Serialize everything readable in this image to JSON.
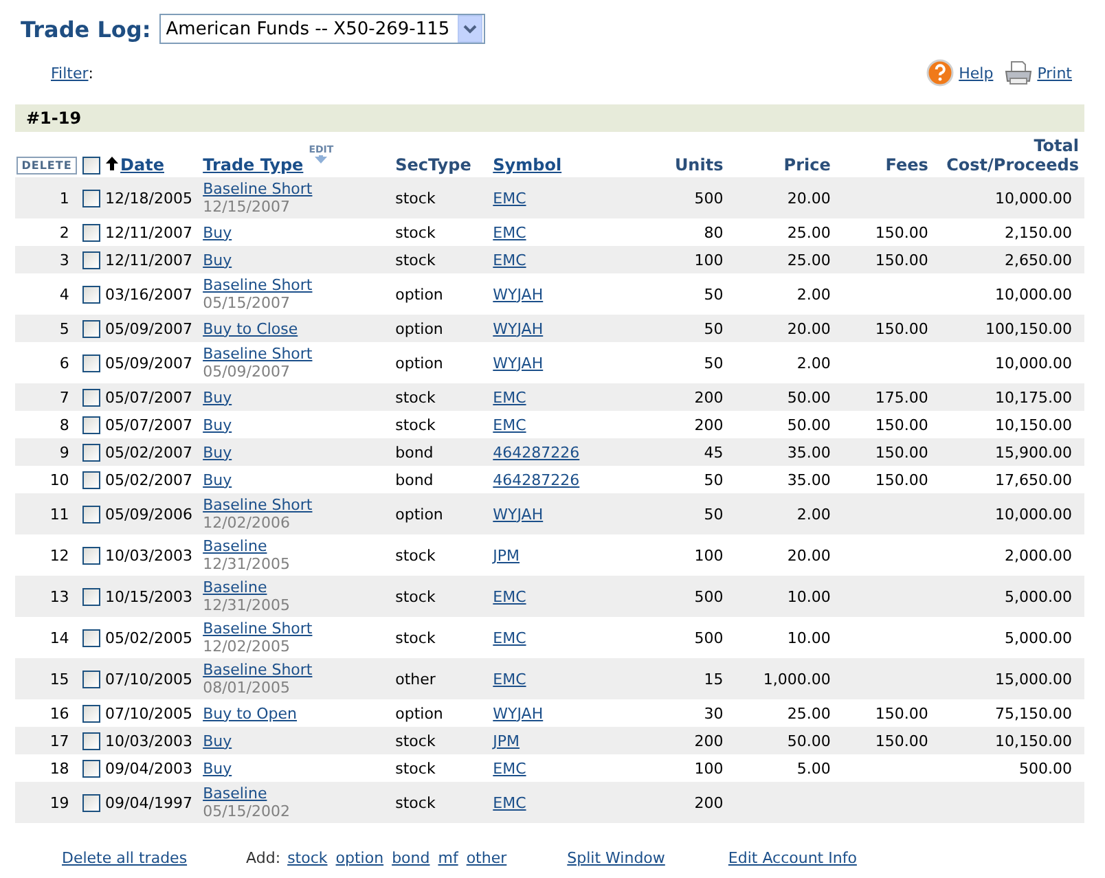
{
  "title": "Trade Log:",
  "account_select": {
    "value": "American Funds -- X50-269-115"
  },
  "filter": {
    "label": "Filter",
    "suffix": ":"
  },
  "toolbar": [
    {
      "kind": "help",
      "label": "Help"
    },
    {
      "kind": "print",
      "label": "Print"
    }
  ],
  "range": "#1-19",
  "delete_button": "DELETE",
  "select_all": {
    "checked": false
  },
  "columns": [
    {
      "label": "Date",
      "kind": "link",
      "sorted": true
    },
    {
      "label": "Trade Type",
      "kind": "link",
      "badge": "EDIT"
    },
    {
      "label": "SecType",
      "kind": "plain"
    },
    {
      "label": "Symbol",
      "kind": "link"
    },
    {
      "label": "Units",
      "kind": "plain"
    },
    {
      "label": "Price",
      "kind": "plain"
    },
    {
      "label": "Fees",
      "kind": "plain"
    },
    {
      "label": "Total Cost/Proceeds",
      "kind": "plain"
    }
  ],
  "rows": [
    {
      "number": "1",
      "checked": false,
      "date": "12/18/2005",
      "trade_type": "Baseline Short",
      "trade_subdate": "12/15/2007",
      "sectype": "stock",
      "symbol": "EMC",
      "units": "500",
      "price": "20.00",
      "total": "10,000.00"
    },
    {
      "number": "2",
      "checked": false,
      "date": "12/11/2007",
      "trade_type": "Buy",
      "sectype": "stock",
      "symbol": "EMC",
      "units": "80",
      "price": "25.00",
      "fees": "150.00",
      "total": "2,150.00"
    },
    {
      "number": "3",
      "checked": false,
      "date": "12/11/2007",
      "trade_type": "Buy",
      "sectype": "stock",
      "symbol": "EMC",
      "units": "100",
      "price": "25.00",
      "fees": "150.00",
      "total": "2,650.00"
    },
    {
      "number": "4",
      "checked": false,
      "date": "03/16/2007",
      "trade_type": "Baseline Short",
      "trade_subdate": "05/15/2007",
      "sectype": "option",
      "symbol": "WYJAH",
      "units": "50",
      "price": "2.00",
      "total": "10,000.00"
    },
    {
      "number": "5",
      "checked": false,
      "date": "05/09/2007",
      "trade_type": "Buy to Close",
      "sectype": "option",
      "symbol": "WYJAH",
      "units": "50",
      "price": "20.00",
      "fees": "150.00",
      "total": "100,150.00"
    },
    {
      "number": "6",
      "checked": false,
      "date": "05/09/2007",
      "trade_type": "Baseline Short",
      "trade_subdate": "05/09/2007",
      "sectype": "option",
      "symbol": "WYJAH",
      "units": "50",
      "price": "2.00",
      "total": "10,000.00"
    },
    {
      "number": "7",
      "checked": false,
      "date": "05/07/2007",
      "trade_type": "Buy",
      "sectype": "stock",
      "symbol": "EMC",
      "units": "200",
      "price": "50.00",
      "fees": "175.00",
      "total": "10,175.00"
    },
    {
      "number": "8",
      "checked": false,
      "date": "05/07/2007",
      "trade_type": "Buy",
      "sectype": "stock",
      "symbol": "EMC",
      "units": "200",
      "price": "50.00",
      "fees": "150.00",
      "total": "10,150.00"
    },
    {
      "number": "9",
      "checked": false,
      "date": "05/02/2007",
      "trade_type": "Buy",
      "sectype": "bond",
      "symbol": "464287226",
      "units": "45",
      "price": "35.00",
      "fees": "150.00",
      "total": "15,900.00"
    },
    {
      "number": "10",
      "checked": false,
      "date": "05/02/2007",
      "trade_type": "Buy",
      "sectype": "bond",
      "symbol": "464287226",
      "units": "50",
      "price": "35.00",
      "fees": "150.00",
      "total": "17,650.00"
    },
    {
      "number": "11",
      "checked": false,
      "date": "05/09/2006",
      "trade_type": "Baseline Short",
      "trade_subdate": "12/02/2006",
      "sectype": "option",
      "symbol": "WYJAH",
      "units": "50",
      "price": "2.00",
      "total": "10,000.00"
    },
    {
      "number": "12",
      "checked": false,
      "date": "10/03/2003",
      "trade_type": "Baseline",
      "trade_subdate": "12/31/2005",
      "sectype": "stock",
      "symbol": "JPM",
      "units": "100",
      "price": "20.00",
      "total": "2,000.00"
    },
    {
      "number": "13",
      "checked": false,
      "date": "10/15/2003",
      "trade_type": "Baseline",
      "trade_subdate": "12/31/2005",
      "sectype": "stock",
      "symbol": "EMC",
      "units": "500",
      "price": "10.00",
      "total": "5,000.00"
    },
    {
      "number": "14",
      "checked": false,
      "date": "05/02/2005",
      "trade_type": "Baseline Short",
      "trade_subdate": "12/02/2005",
      "sectype": "stock",
      "symbol": "EMC",
      "units": "500",
      "price": "10.00",
      "total": "5,000.00"
    },
    {
      "number": "15",
      "checked": false,
      "date": "07/10/2005",
      "trade_type": "Baseline Short",
      "trade_subdate": "08/01/2005",
      "sectype": "other",
      "symbol": "EMC",
      "units": "15",
      "price": "1,000.00",
      "total": "15,000.00"
    },
    {
      "number": "16",
      "checked": false,
      "date": "07/10/2005",
      "trade_type": "Buy to Open",
      "sectype": "option",
      "symbol": "WYJAH",
      "units": "30",
      "price": "25.00",
      "fees": "150.00",
      "total": "75,150.00"
    },
    {
      "number": "17",
      "checked": false,
      "date": "10/03/2003",
      "trade_type": "Buy",
      "sectype": "stock",
      "symbol": "JPM",
      "units": "200",
      "price": "50.00",
      "fees": "150.00",
      "total": "10,150.00"
    },
    {
      "number": "18",
      "checked": false,
      "date": "09/04/2003",
      "trade_type": "Buy",
      "sectype": "stock",
      "symbol": "EMC",
      "units": "100",
      "price": "5.00",
      "total": "500.00"
    },
    {
      "number": "19",
      "checked": false,
      "date": "09/04/1997",
      "trade_type": "Baseline",
      "trade_subdate": "05/15/2002",
      "sectype": "stock",
      "symbol": "EMC",
      "units": "200"
    }
  ],
  "footer": {
    "delete_all": "Delete all trades",
    "add_label": "Add:",
    "add_links": [
      "stock",
      "option",
      "bond",
      "mf",
      "other"
    ],
    "split_window": "Split Window",
    "edit_account": "Edit Account Info"
  }
}
